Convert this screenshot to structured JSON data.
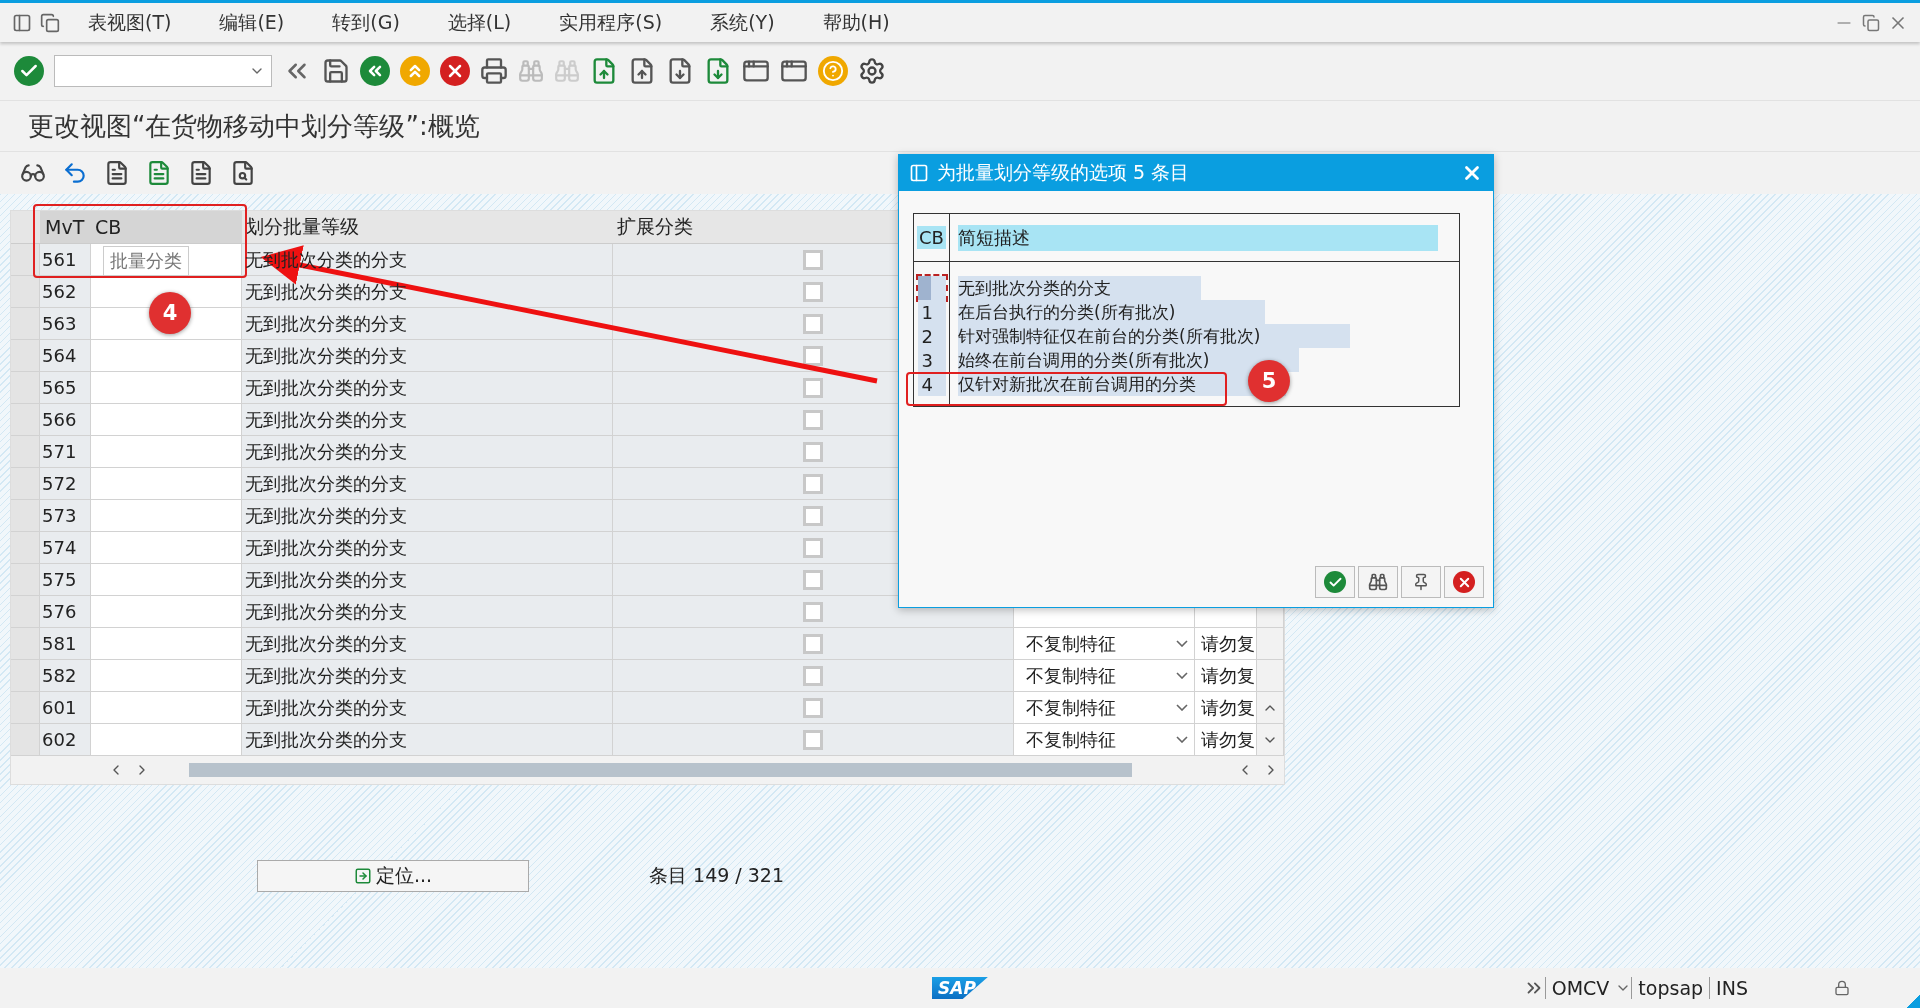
{
  "menu_bar": {
    "items": [
      "表视图(T)",
      "编辑(E)",
      "转到(G)",
      "选择(L)",
      "实用程序(S)",
      "系统(Y)",
      "帮助(H)"
    ]
  },
  "title": "更改视图“在货物移动中划分等级”:概览",
  "table": {
    "columns": [
      "MvT",
      "CB",
      "划分批量等级",
      "扩展分类"
    ],
    "tooltip": "批量分类",
    "rows": [
      {
        "mvt": "561",
        "cb": "",
        "grade": "无到批次分类的分支",
        "extended": false
      },
      {
        "mvt": "562",
        "cb": "",
        "grade": "无到批次分类的分支",
        "extended": false
      },
      {
        "mvt": "563",
        "cb": "",
        "grade": "无到批次分类的分支",
        "extended": false
      },
      {
        "mvt": "564",
        "cb": "",
        "grade": "无到批次分类的分支",
        "extended": false
      },
      {
        "mvt": "565",
        "cb": "",
        "grade": "无到批次分类的分支",
        "extended": false
      },
      {
        "mvt": "566",
        "cb": "",
        "grade": "无到批次分类的分支",
        "extended": false
      },
      {
        "mvt": "571",
        "cb": "",
        "grade": "无到批次分类的分支",
        "extended": false
      },
      {
        "mvt": "572",
        "cb": "",
        "grade": "无到批次分类的分支",
        "extended": false
      },
      {
        "mvt": "573",
        "cb": "",
        "grade": "无到批次分类的分支",
        "extended": false
      },
      {
        "mvt": "574",
        "cb": "",
        "grade": "无到批次分类的分支",
        "extended": false
      },
      {
        "mvt": "575",
        "cb": "",
        "grade": "无到批次分类的分支",
        "extended": false
      },
      {
        "mvt": "576",
        "cb": "",
        "grade": "无到批次分类的分支",
        "extended": false
      },
      {
        "mvt": "581",
        "cb": "",
        "grade": "无到批次分类的分支",
        "extended": false,
        "column_5": "不复制特征",
        "column_6": "请勿复"
      },
      {
        "mvt": "582",
        "cb": "",
        "grade": "无到批次分类的分支",
        "extended": false,
        "column_5": "不复制特征",
        "column_6": "请勿复"
      },
      {
        "mvt": "601",
        "cb": "",
        "grade": "无到批次分类的分支",
        "extended": false,
        "column_5": "不复制特征",
        "column_6": "请勿复"
      },
      {
        "mvt": "602",
        "cb": "",
        "grade": "无到批次分类的分支",
        "extended": false,
        "column_5": "不复制特征",
        "column_6": "请勿复"
      }
    ]
  },
  "position_button": "定位...",
  "entry_count": "条目 149 / 321",
  "status_bar": {
    "logo": "SAP",
    "transaction": "OMCV",
    "user": "topsap",
    "mode": "INS"
  },
  "dialog": {
    "title": "为批量划分等级的选项 5 条目",
    "columns": [
      "CB",
      "简短描述"
    ],
    "rows": [
      {
        "cb": "",
        "description": "无到批次分类的分支",
        "focused": true
      },
      {
        "cb": "1",
        "description": "在后台执行的分类(所有批次)",
        "focused": false
      },
      {
        "cb": "2",
        "description": "针对强制特征仅在前台的分类(所有批次)",
        "focused": false
      },
      {
        "cb": "3",
        "description": "始终在前台调用的分类(所有批次)",
        "focused": false
      },
      {
        "cb": "4",
        "description": "仅针对新批次在前台调用的分类",
        "focused": false
      }
    ]
  },
  "annotations": [
    {
      "label": "4"
    },
    {
      "label": "5"
    }
  ]
}
